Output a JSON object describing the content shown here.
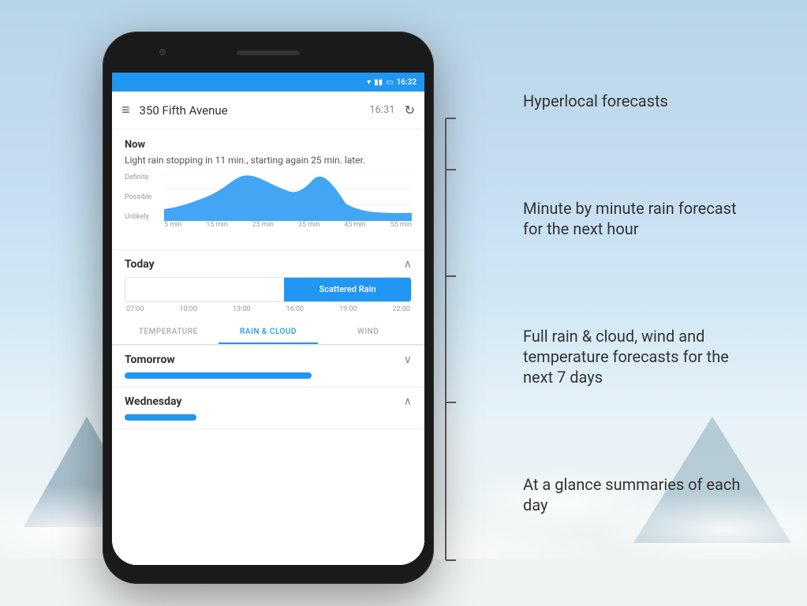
{
  "background": {
    "gradient_start": "#b8d4e8",
    "gradient_end": "#f0f4f0"
  },
  "status_bar": {
    "time": "16:32",
    "icons": [
      "wifi",
      "signal",
      "battery"
    ]
  },
  "app_bar": {
    "menu_icon": "≡",
    "title": "350 Fifth Avenue",
    "time": "16:31",
    "refresh_icon": "↻"
  },
  "now_section": {
    "label": "Now",
    "description": "Light rain stopping in 11 min., starting again 25 min. later."
  },
  "chart": {
    "y_labels": [
      "Definite",
      "Possible",
      "Unlikely"
    ],
    "x_labels": [
      "5 min",
      "15 min",
      "25 min",
      "35 min",
      "45 min",
      "55 min"
    ]
  },
  "today_section": {
    "title": "Today",
    "chevron": "∧",
    "rain_label": "Scattered Rain",
    "hours": [
      "07:00",
      "10:00",
      "13:00",
      "16:00",
      "19:00",
      "22:00"
    ],
    "tabs": [
      {
        "id": "temperature",
        "label": "TEMPERATURE",
        "active": false
      },
      {
        "id": "rain_cloud",
        "label": "RAIN & CLOUD",
        "active": true
      },
      {
        "id": "wind",
        "label": "WIND",
        "active": false
      }
    ]
  },
  "tomorrow_section": {
    "title": "Tomorrow",
    "chevron": "∨"
  },
  "wednesday_section": {
    "title": "Wednesday",
    "chevron": "∧"
  },
  "features": [
    {
      "id": "hyperlocal",
      "text": "Hyperlocal forecasts"
    },
    {
      "id": "minute",
      "text": "Minute by minute rain forecast for the next hour"
    },
    {
      "id": "full",
      "text": "Full rain & cloud, wind and temperature forecasts for the next 7 days"
    },
    {
      "id": "glance",
      "text": "At a glance summaries of each day"
    }
  ]
}
